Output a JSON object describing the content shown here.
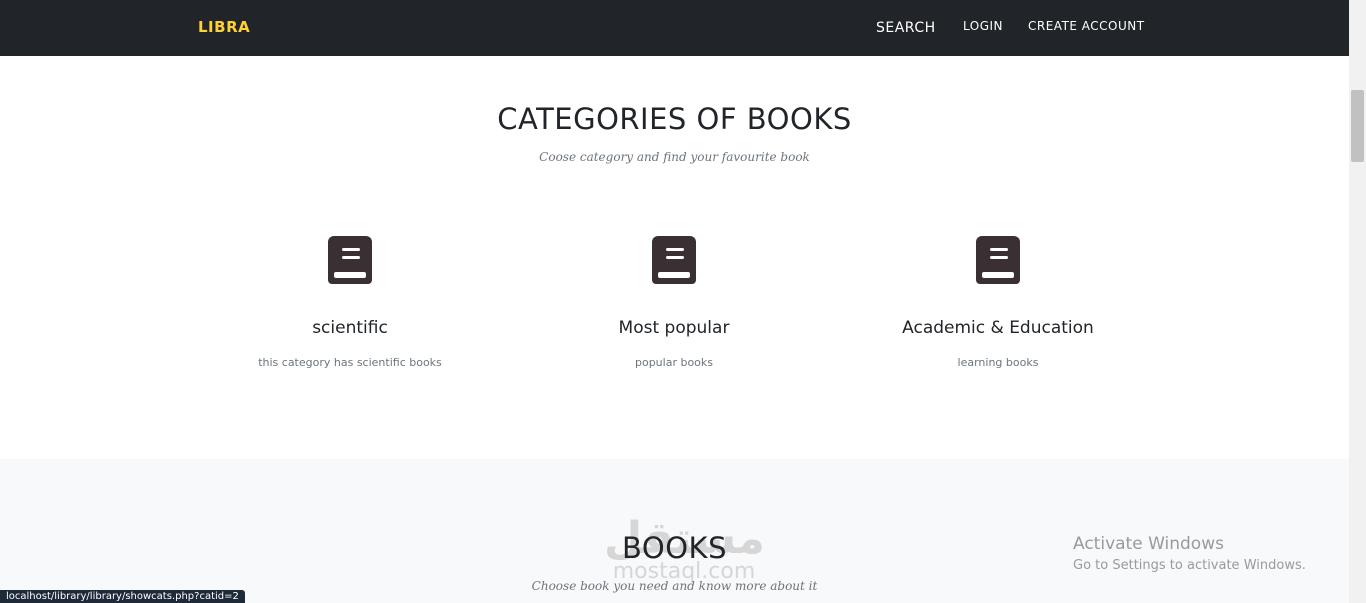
{
  "navbar": {
    "brand": "LIBRA",
    "links": {
      "search": "SEARCH",
      "login": "LOGIN",
      "create_account": "CREATE ACCOUNT"
    },
    "brand_color": "#fed136",
    "background": "#212529"
  },
  "categories_section": {
    "title": "CATEGORIES OF BOOKS",
    "subtitle": "Coose category and find your favourite book",
    "items": [
      {
        "icon": "book-icon",
        "name": "scientific",
        "description": "this category has scientific books"
      },
      {
        "icon": "book-icon",
        "name": "Most popular",
        "description": "popular books"
      },
      {
        "icon": "book-icon",
        "name": "Academic & Education",
        "description": "learning books"
      }
    ]
  },
  "books_section": {
    "title": "BOOKS",
    "subtitle": "Choose book you need and know more about it",
    "watermark_glyph": "مستقل",
    "watermark_text": "mostaql.com"
  },
  "windows_activation": {
    "line1": "Activate Windows",
    "line2": "Go to Settings to activate Windows."
  },
  "status_bar": {
    "url": "localhost/library/library/showcats.php?catid=2"
  }
}
